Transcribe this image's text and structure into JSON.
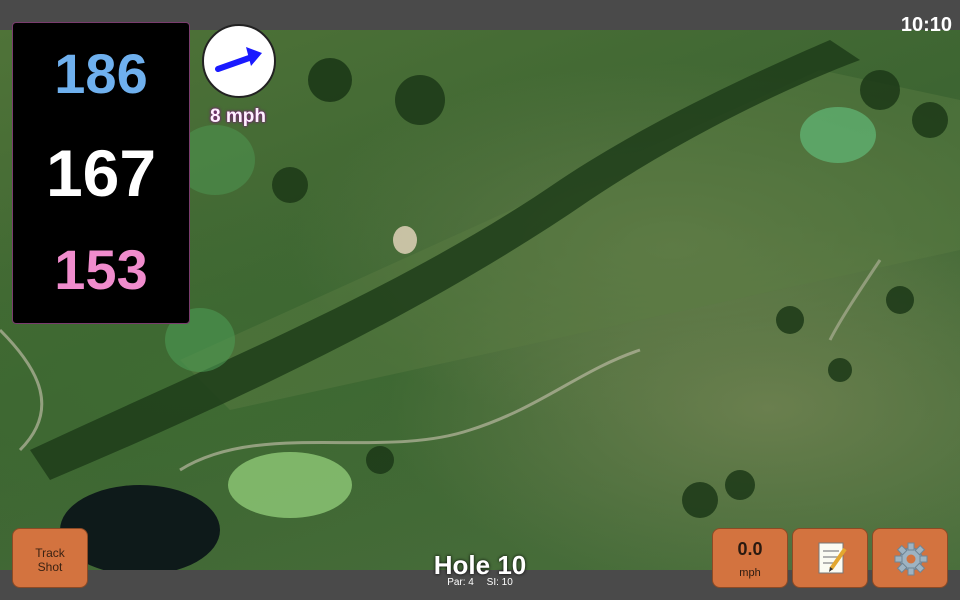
{
  "clock": "10:10",
  "yardages": {
    "back": "186",
    "middle": "167",
    "front": "153"
  },
  "wind": {
    "speed": "8 mph",
    "arrow_icon": "arrow-right-icon",
    "arrow_color": "#1a1aff"
  },
  "buttons": {
    "track_shot_line1": "Track",
    "track_shot_line2": "Shot",
    "speed_value": "0.0",
    "speed_unit": "mph",
    "notes_icon": "notepad-icon",
    "settings_icon": "gear-icon"
  },
  "hole": {
    "title": "Hole 10",
    "par": "Par: 4",
    "si": "SI: 10"
  },
  "colors": {
    "back_yardage": "#6fb0ee",
    "middle_yardage": "#ffffff",
    "front_yardage": "#f08ccd",
    "button_bg": "#d3733f"
  }
}
